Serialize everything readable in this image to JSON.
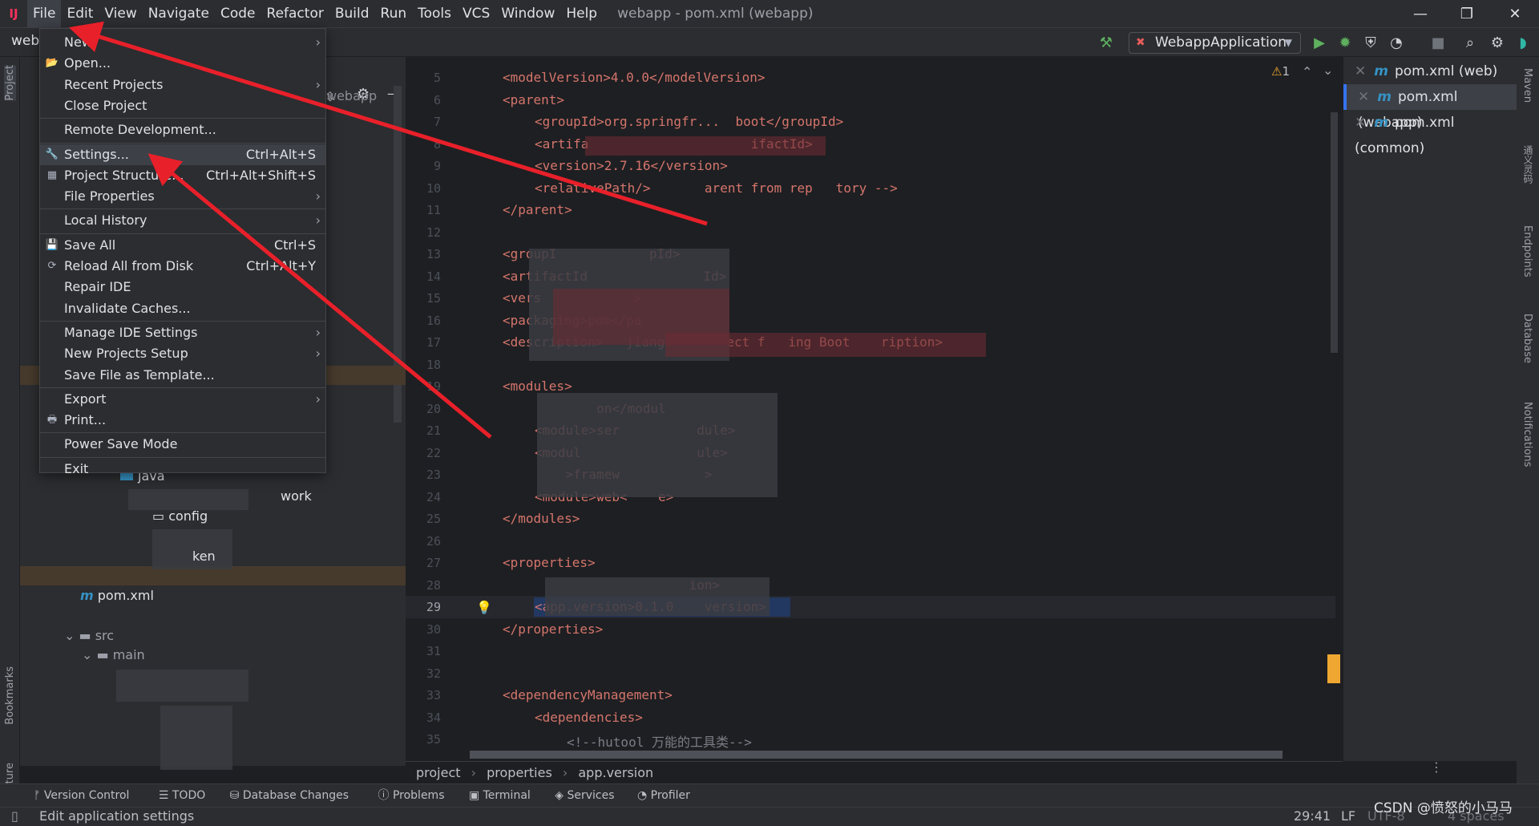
{
  "menubar": {
    "items": [
      "File",
      "Edit",
      "View",
      "Navigate",
      "Code",
      "Refactor",
      "Build",
      "Run",
      "Tools",
      "VCS",
      "Window",
      "Help"
    ],
    "title": "webapp - pom.xml (webapp)"
  },
  "toolbar": {
    "project_name": "web",
    "run_config": "WebappApplication"
  },
  "project_panel": {
    "header": "webapp",
    "tree": [
      "java",
      "work",
      "config",
      "ken",
      "pom.xml",
      "src",
      "main"
    ]
  },
  "file_menu": [
    {
      "label": "New",
      "submenu": true
    },
    {
      "label": "Open...",
      "icon": "folder-open-icon"
    },
    {
      "label": "Recent Projects",
      "submenu": true
    },
    {
      "label": "Close Project"
    },
    {
      "label": "Remote Development..."
    },
    {
      "label": "Settings...",
      "shortcut": "Ctrl+Alt+S",
      "icon": "wrench-icon",
      "highlighted": true
    },
    {
      "label": "Project Structure...",
      "shortcut": "Ctrl+Alt+Shift+S",
      "icon": "project-structure-icon"
    },
    {
      "label": "File Properties",
      "submenu": true
    },
    {
      "label": "Local History",
      "submenu": true
    },
    {
      "label": "Save All",
      "shortcut": "Ctrl+S",
      "icon": "save-icon"
    },
    {
      "label": "Reload All from Disk",
      "shortcut": "Ctrl+Alt+Y",
      "icon": "reload-icon"
    },
    {
      "label": "Repair IDE"
    },
    {
      "label": "Invalidate Caches..."
    },
    {
      "label": "Manage IDE Settings",
      "submenu": true
    },
    {
      "label": "New Projects Setup",
      "submenu": true
    },
    {
      "label": "Save File as Template..."
    },
    {
      "label": "Export",
      "submenu": true
    },
    {
      "label": "Print...",
      "icon": "print-icon"
    },
    {
      "label": "Power Save Mode"
    },
    {
      "label": "Exit"
    }
  ],
  "editor": {
    "warnings": "1",
    "current_line": "29",
    "lines": [
      {
        "n": "5",
        "t": "<modelVersion>4.0.0</modelVersion>",
        "i": 0
      },
      {
        "n": "6",
        "t": "<parent>",
        "i": 0
      },
      {
        "n": "7",
        "t": "<groupId>org.springfr...  boot</groupId>",
        "i": 1
      },
      {
        "n": "8",
        "t": "<artifa                     ifactId>",
        "i": 1
      },
      {
        "n": "9",
        "t": "<version>2.7.16</version>",
        "i": 1
      },
      {
        "n": "10",
        "t": "<relativePath/>       arent from rep   tory -->",
        "i": 1
      },
      {
        "n": "11",
        "t": "</parent>",
        "i": 0
      },
      {
        "n": "12",
        "t": "",
        "i": 0
      },
      {
        "n": "13",
        "t": "<groupI            pId>",
        "i": 0
      },
      {
        "n": "14",
        "t": "<artifactId               Id>",
        "i": 0
      },
      {
        "n": "15",
        "t": "<vers            >",
        "i": 0
      },
      {
        "n": "16",
        "t": "<packaging>pom</pa",
        "i": 0
      },
      {
        "n": "17",
        "t": "<description>   jiang        ect f   ing Boot    ription>",
        "i": 0
      },
      {
        "n": "18",
        "t": "",
        "i": 0
      },
      {
        "n": "19",
        "t": "<modules>",
        "i": 0
      },
      {
        "n": "20",
        "t": "        on</modul",
        "i": 1
      },
      {
        "n": "21",
        "t": "<module>ser          dule>",
        "i": 1
      },
      {
        "n": "22",
        "t": "<modul               ule>",
        "i": 1
      },
      {
        "n": "23",
        "t": "    >framew           >",
        "i": 1
      },
      {
        "n": "24",
        "t": "<module>web<    e>",
        "i": 1
      },
      {
        "n": "25",
        "t": "</modules>",
        "i": 0
      },
      {
        "n": "26",
        "t": "",
        "i": 0
      },
      {
        "n": "27",
        "t": "<properties>",
        "i": 0
      },
      {
        "n": "28",
        "t": "                    ion>",
        "i": 1
      },
      {
        "n": "29",
        "t": "<app.version>0.1.0    version>",
        "i": 1
      },
      {
        "n": "30",
        "t": "</properties>",
        "i": 0
      },
      {
        "n": "31",
        "t": "",
        "i": 0
      },
      {
        "n": "32",
        "t": "",
        "i": 0
      },
      {
        "n": "33",
        "t": "<dependencyManagement>",
        "i": 0
      },
      {
        "n": "34",
        "t": "<dependencies>",
        "i": 1
      },
      {
        "n": "35",
        "t": "<!--hutool 万能的工具类-->",
        "i": 2
      }
    ]
  },
  "open_files": [
    {
      "label": "pom.xml (web)"
    },
    {
      "label": "pom.xml (webapp)",
      "selected": true
    },
    {
      "label": "pom.xml (common)"
    }
  ],
  "breadcrumb": [
    "project",
    "properties",
    "app.version"
  ],
  "tool_windows": [
    "Version Control",
    "TODO",
    "Database Changes",
    "Problems",
    "Terminal",
    "Services",
    "Profiler"
  ],
  "left_stripe": [
    "Project",
    "Bookmarks",
    "Structure"
  ],
  "right_stripe": [
    "Maven",
    "通义灵码",
    "Endpoints",
    "Database",
    "Notifications"
  ],
  "status": {
    "message": "Edit application settings",
    "position": "29:41",
    "line_sep": "LF",
    "encoding": "UTF-8",
    "indent": "4 spaces",
    "watermark": "CSDN @愤怒的小马马"
  },
  "colors": {
    "annotation_arrow": "#e8202a",
    "accent": "#3574f0",
    "tag": "#d5756c"
  }
}
